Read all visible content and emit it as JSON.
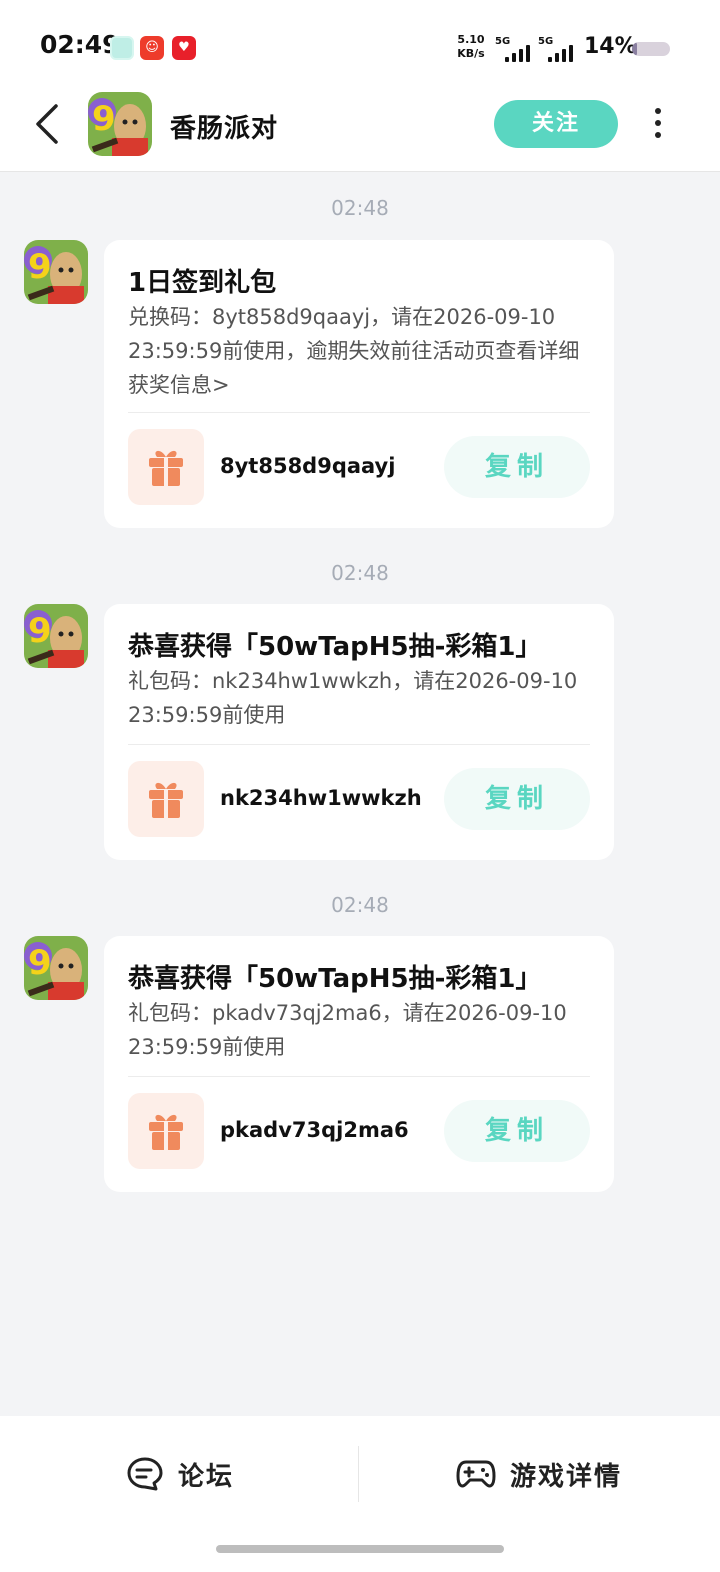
{
  "status_bar": {
    "time": "02:49",
    "net_speed_value": "5.10",
    "net_speed_unit": "KB/s",
    "signal1_label": "5G",
    "signal2_label": "5G",
    "battery_percent": "14%",
    "battery_level": 0.14
  },
  "header": {
    "title": "香肠派对",
    "follow_label": "关注"
  },
  "messages": [
    {
      "time": "02:48",
      "title": "1日签到礼包",
      "body": "兑换码：8yt858d9qaayj，请在2026-09-10 23:59:59前使用，逾期失效前往活动页查看详细获奖信息>",
      "code": "8yt858d9qaayj",
      "copy_label": "复制"
    },
    {
      "time": "02:48",
      "title": "恭喜获得「50wTapH5抽-彩箱1」",
      "body": "礼包码：nk234hw1wwkzh，请在2026-09-10 23:59:59前使用",
      "code": "nk234hw1wwkzh",
      "copy_label": "复制"
    },
    {
      "time": "02:48",
      "title": "恭喜获得「50wTapH5抽-彩箱1」",
      "body": "礼包码：pkadv73qj2ma6，请在2026-09-10 23:59:59前使用",
      "code": "pkadv73qj2ma6",
      "copy_label": "复制"
    }
  ],
  "bottom_bar": {
    "forum_label": "论坛",
    "detail_label": "游戏详情"
  },
  "colors": {
    "accent": "#5ad6c1",
    "gift_icon": "#f08a5d",
    "background": "#f3f4f6"
  }
}
